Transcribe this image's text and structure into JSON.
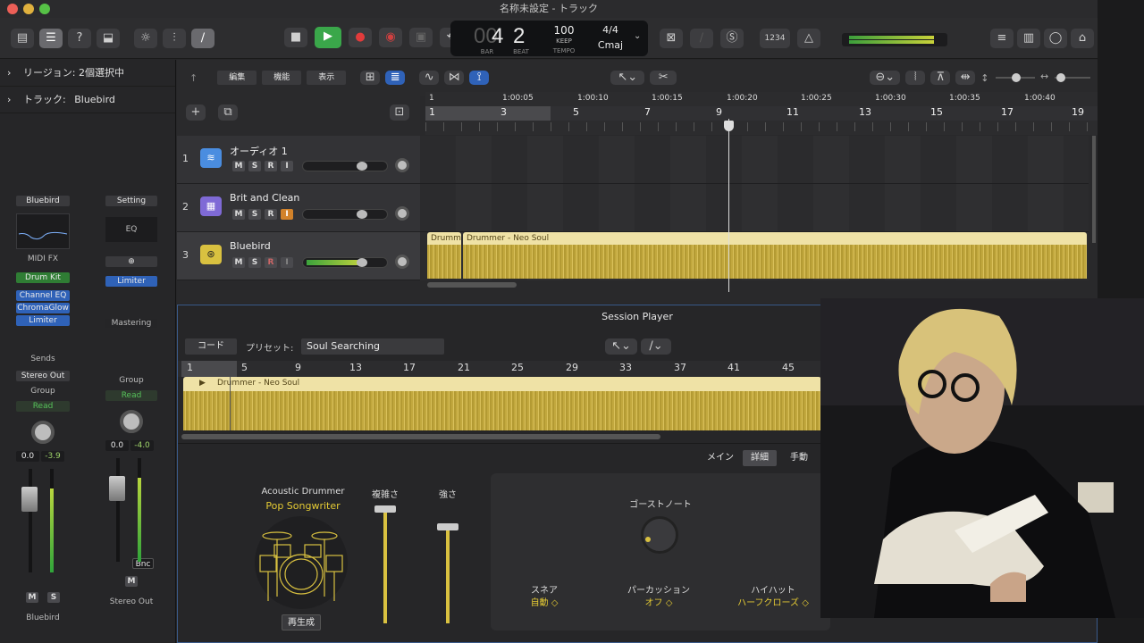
{
  "window": {
    "title": "名称未設定 - トラック"
  },
  "lcd": {
    "bar": "4",
    "beat": "2",
    "bar_label": "BAR",
    "beat_label": "BEAT",
    "tempo": "100",
    "keep": "KEEP",
    "tempo_label": "TEMPO",
    "sig": "4/4",
    "key": "Cmaj"
  },
  "toolbar": {
    "count_in": "1234"
  },
  "inspector": {
    "region": "リージョン: 2個選択中",
    "track_prefix": "トラック:",
    "track_name": "Bluebird",
    "strip1": {
      "setting": "Bluebird",
      "midi_fx": "MIDI FX",
      "instrument": "Drum Kit",
      "fx": [
        "Channel EQ",
        "ChromaGlow",
        "Limiter"
      ],
      "sends": "Sends",
      "output": "Stereo Out",
      "group": "Group",
      "automation": "Read",
      "val1": "0.0",
      "val2": "-3.9",
      "mute": "M",
      "solo": "S",
      "name": "Bluebird"
    },
    "strip2": {
      "setting": "Setting",
      "eq": "EQ",
      "fx": "Limiter",
      "mastering": "Mastering",
      "group": "Group",
      "automation": "Read",
      "val1": "0.0",
      "val2": "-4.0",
      "bnc": "Bnc",
      "mute": "M",
      "name": "Stereo Out"
    }
  },
  "tracks_toolbar": {
    "edit": "編集",
    "function": "機能",
    "view": "表示"
  },
  "ruler": {
    "time": [
      "1",
      "1:00:05",
      "1:00:10",
      "1:00:15",
      "1:00:20",
      "1:00:25",
      "1:00:30",
      "1:00:35",
      "1:00:40"
    ],
    "bars": [
      "1",
      "3",
      "5",
      "7",
      "9",
      "11",
      "13",
      "15",
      "17",
      "19"
    ]
  },
  "tracks": [
    {
      "num": "1",
      "name": "オーディオ 1",
      "m": "M",
      "s": "S",
      "r": "R",
      "i": "I",
      "color": "#4a8de0"
    },
    {
      "num": "2",
      "name": "Brit and Clean",
      "m": "M",
      "s": "S",
      "r": "R",
      "i": "I",
      "color": "#7f6ad6"
    },
    {
      "num": "3",
      "name": "Bluebird",
      "m": "M",
      "s": "S",
      "r": "R",
      "i": "I",
      "color": "#d9c140"
    }
  ],
  "regions": {
    "r1": "Drumm",
    "r2": "Drummer - Neo Soul"
  },
  "session": {
    "title": "Session Player",
    "chord": "コード",
    "preset_label": "プリセット:",
    "preset": "Soul Searching",
    "bars": [
      "1",
      "5",
      "9",
      "13",
      "17",
      "21",
      "25",
      "29",
      "33",
      "37",
      "41",
      "45"
    ],
    "region": "Drummer - Neo Soul",
    "tabs": [
      "メイン",
      "詳細",
      "手動"
    ],
    "drummer_type": "Acoustic Drummer",
    "drummer_name": "Pop Songwriter",
    "complexity": "複雑さ",
    "intensity": "強さ",
    "play": "再生成",
    "ghost": "ゴーストノート",
    "snare_label": "スネア",
    "snare_val": "自動 ◇",
    "perc_label": "パーカッション",
    "perc_val": "オフ ◇",
    "hihat_label": "ハイハット",
    "hihat_val": "ハーフクローズ ◇"
  }
}
